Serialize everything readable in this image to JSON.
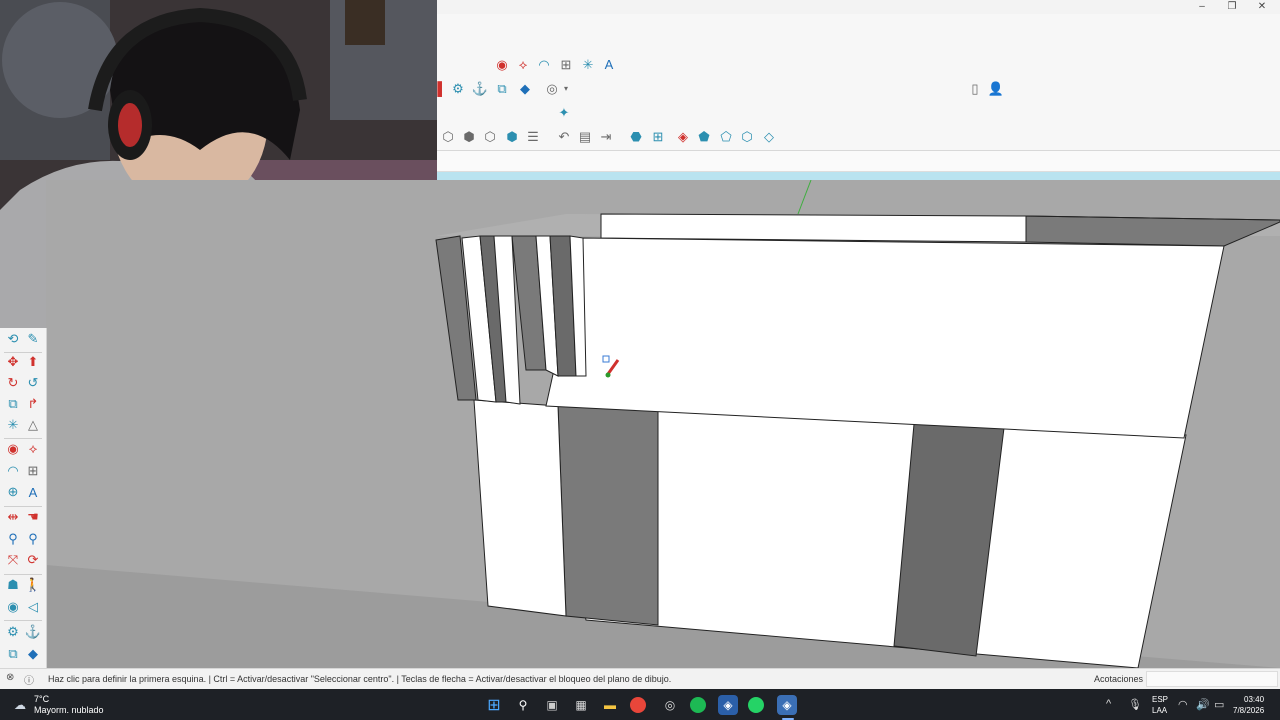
{
  "window": {
    "minimize_icon": "minimize-icon",
    "maximize_icon": "maximize-icon",
    "close_icon": "close-icon",
    "minimize_glyph": "–",
    "maximize_glyph": "❐",
    "close_glyph": "✕"
  },
  "toolbars": {
    "row1": [
      "circle-icon",
      "arc-icon",
      "arc2-icon",
      "dimension-icon",
      "text-icon",
      "axes-icon"
    ],
    "row2": [
      "section-icon",
      "layers-icon",
      "styles-icon",
      "components-icon",
      "user-icon"
    ],
    "row3": [
      "sparkle-icon"
    ],
    "row4": [
      "iso-view-icon",
      "top-view-icon",
      "front-view-icon",
      "right-view-icon",
      "back-view-icon",
      "left-view-icon",
      "walk-icon",
      "tape-icon",
      "dim-icon",
      "sandbox-icon",
      "stamp-icon",
      "drape-icon",
      "add-detail-icon",
      "flip-edge-icon",
      "smoove-icon"
    ],
    "right": [
      "new-file-icon",
      "account-icon"
    ]
  },
  "status": {
    "hint": "Haz clic para definir la primera esquina. | Ctrl = Activar/desactivar \"Seleccionar centro\". | Teclas de flecha = Activar/desactivar el bloqueo del plano de dibujo.",
    "measure_label": "Acotaciones",
    "measure_value": ""
  },
  "taskbar": {
    "temperature": "7°C",
    "weather": "Mayorm. nublado",
    "lang_top": "ESP",
    "lang_bottom": "LAA",
    "time": "03:40",
    "date": "7/8/2026",
    "apps": [
      "windows-start-icon",
      "search-icon",
      "task-view-icon",
      "file-explorer-icon",
      "folder-icon",
      "chrome-icon",
      "obs-icon",
      "spotify-icon",
      "sketchup-icon",
      "whatsapp-icon",
      "sketchup-active-icon"
    ]
  },
  "colors": {
    "viewport_bg": "#a8a8a8",
    "face_white": "#ffffff",
    "face_gray": "#7a7a7a",
    "face_dark": "#696969",
    "cyan": "#b9e3f0"
  }
}
